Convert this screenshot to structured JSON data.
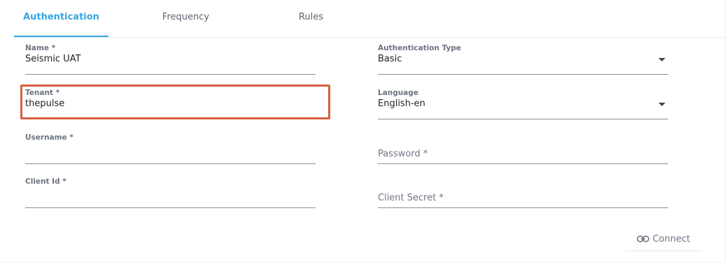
{
  "tabs": [
    {
      "label": "Authentication",
      "active": true
    },
    {
      "label": "Frequency",
      "active": false
    },
    {
      "label": "Rules",
      "active": false
    }
  ],
  "form": {
    "name": {
      "label": "Name *",
      "value": "Seismic UAT"
    },
    "tenant": {
      "label": "Tenant *",
      "value": "thepulse"
    },
    "username": {
      "label": "Username *",
      "value": ""
    },
    "client_id": {
      "label": "Client Id *",
      "value": ""
    },
    "auth_type": {
      "label": "Authentication Type",
      "value": "Basic"
    },
    "language": {
      "label": "Language",
      "value": "English-en"
    },
    "password": {
      "placeholder": "Password *"
    },
    "client_secret": {
      "placeholder": "Client Secret *"
    }
  },
  "actions": {
    "connect_label": "Connect",
    "connect_icon": "link-icon"
  },
  "colors": {
    "accent": "#37a6e0",
    "highlight": "#d9603d"
  }
}
